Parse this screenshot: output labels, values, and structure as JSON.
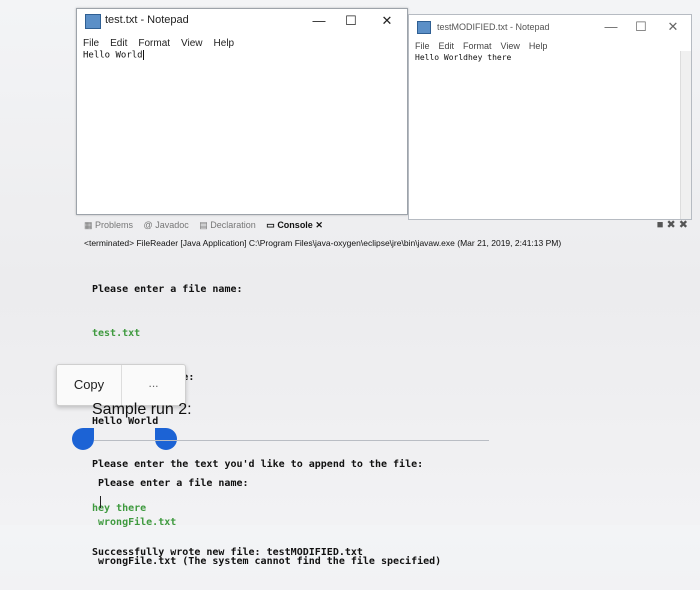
{
  "notepad_left": {
    "title": "test.txt - Notepad",
    "menu": [
      "File",
      "Edit",
      "Format",
      "View",
      "Help"
    ],
    "content": "Hello World",
    "min": "—",
    "max": "☐",
    "close": "✕"
  },
  "notepad_right": {
    "title": "testMODIFIED.txt - Notepad",
    "menu": [
      "File",
      "Edit",
      "Format",
      "View",
      "Help"
    ],
    "content": "Hello Worldhey there",
    "min": "—",
    "max": "☐",
    "close": "✕"
  },
  "console": {
    "tabs": [
      "Problems",
      "Javadoc",
      "Declaration",
      "Console"
    ],
    "terminated": "<terminated> FileReader [Java Application] C:\\Program Files\\java-oxygen\\eclipse\\jre\\bin\\javaw.exe (Mar 21, 2019, 2:41:13 PM)",
    "lines": [
      {
        "text": "Please enter a file name:",
        "input": false
      },
      {
        "text": "test.txt",
        "input": true
      },
      {
        "text": "Contents of file:",
        "input": false
      },
      {
        "text": "Hello World",
        "input": false
      },
      {
        "text": "Please enter the text you'd like to append to the file:",
        "input": false
      },
      {
        "text": "hey there",
        "input": true
      },
      {
        "text": "Successfully wrote new file: testMODIFIED.txt",
        "input": false
      }
    ]
  },
  "popup": {
    "copy": "Copy",
    "more": "..."
  },
  "sample_heading": "Sample run 2:",
  "sample_lines": [
    {
      "text": "Please enter a file name:",
      "input": false
    },
    {
      "text": "wrongFile.txt",
      "input": true
    },
    {
      "text": "wrongFile.txt (The system cannot find the file specified)",
      "input": false
    }
  ],
  "colors": {
    "input_green": "#3f9a3f",
    "handle_blue": "#1c63d5"
  }
}
